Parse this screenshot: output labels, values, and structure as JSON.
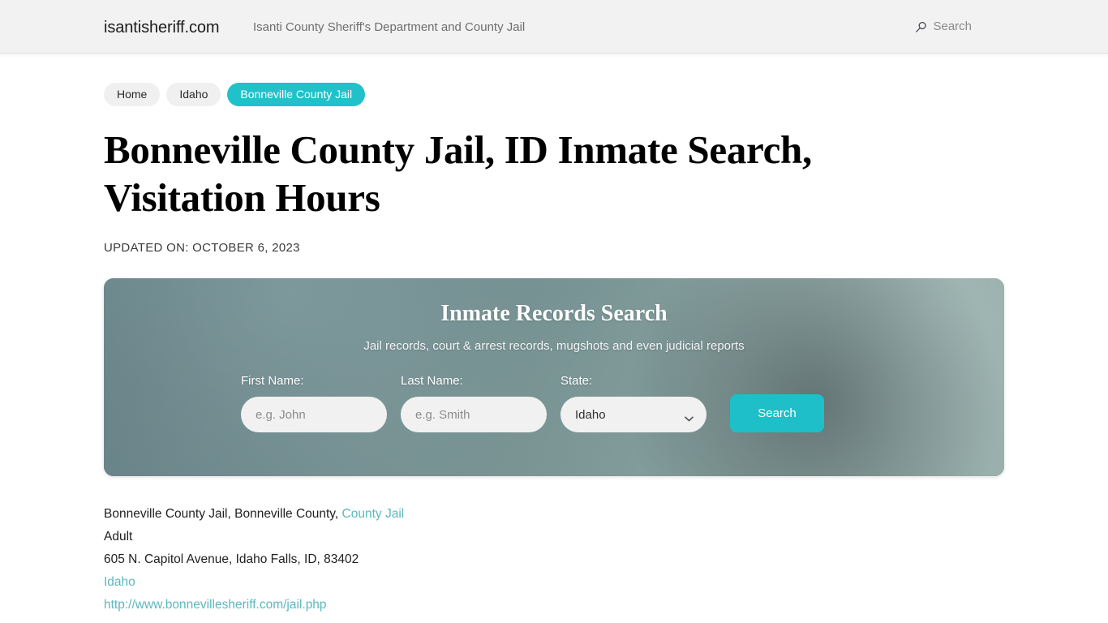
{
  "header": {
    "site_title": "isantisheriff.com",
    "tagline": "Isanti County Sheriff's Department and County Jail",
    "search_label": "Search",
    "search_icon": "search-icon",
    "background_color": "#f2f2f2"
  },
  "breadcrumb": {
    "items": [
      {
        "label": "Home",
        "current": false
      },
      {
        "label": "Idaho",
        "current": false
      },
      {
        "label": "Bonneville County Jail",
        "current": true
      }
    ],
    "active_color": "#21c1ca",
    "inactive_color": "#f0f0f0"
  },
  "page": {
    "title": "Bonneville County Jail, ID Inmate Search, Visitation Hours",
    "updated_on": "UPDATED ON: OCTOBER 6, 2023"
  },
  "search_card": {
    "title": "Inmate Records Search",
    "subtitle": "Jail records, court & arrest records, mugshots and even judicial reports",
    "first_name": {
      "label": "First Name:",
      "placeholder": "e.g. John",
      "value": ""
    },
    "last_name": {
      "label": "Last Name:",
      "placeholder": "e.g. Smith",
      "value": ""
    },
    "state": {
      "label": "State:",
      "selected": "Idaho",
      "chevron_icon": "chevron-down-icon"
    },
    "submit_label": "Search",
    "accent_color": "#1ebfc8"
  },
  "facility": {
    "line1_text": "Bonneville County Jail, Bonneville County, ",
    "line1_link": "County Jail",
    "line2": "Adult",
    "line3": "605 N. Capitol Avenue, Idaho Falls, ID, 83402",
    "line4_link": "Idaho",
    "line5_link": "http://www.bonnevillesheriff.com/jail.php",
    "link_color": "#5bb8bd"
  }
}
